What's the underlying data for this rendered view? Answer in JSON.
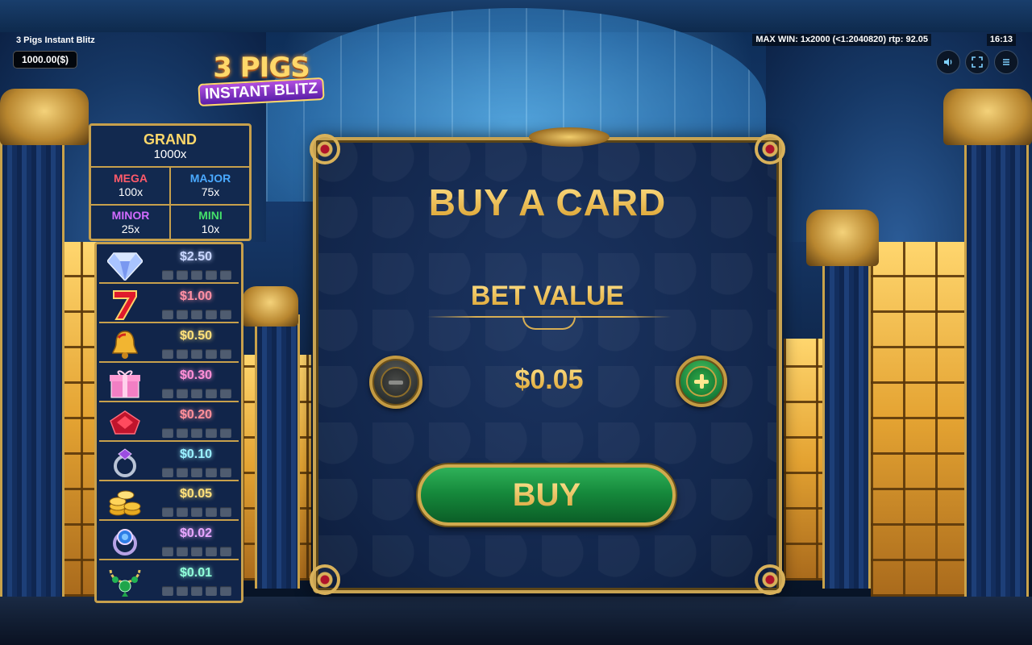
{
  "hud": {
    "game_title": "3 Pigs Instant Blitz",
    "balance": "1000.00($)",
    "max_win_info": "MAX WIN: 1x2000 (<1:2040820) rtp: 92.05",
    "clock": "16:13",
    "sound_icon": "speaker-icon",
    "fullscreen_icon": "fullscreen-icon",
    "menu_icon": "hamburger-menu-icon"
  },
  "logo": {
    "line1": "3 PIGS",
    "line2": "INSTANT BLITZ"
  },
  "jackpots": {
    "grand": {
      "label": "GRAND",
      "multiplier": "1000x",
      "color": "#ffd86a"
    },
    "mega": {
      "label": "MEGA",
      "multiplier": "100x",
      "color": "#ff5a6a"
    },
    "major": {
      "label": "MAJOR",
      "multiplier": "75x",
      "color": "#49a9ff"
    },
    "minor": {
      "label": "MINOR",
      "multiplier": "25x",
      "color": "#d26bff"
    },
    "mini": {
      "label": "MINI",
      "multiplier": "10x",
      "color": "#45e06a"
    }
  },
  "paytable": [
    {
      "icon": "diamond-icon",
      "prize": "$2.50",
      "color": "#c9d6ff"
    },
    {
      "icon": "seven-icon",
      "prize": "$1.00",
      "color": "#ff8fa4"
    },
    {
      "icon": "bell-icon",
      "prize": "$0.50",
      "color": "#ffe07a"
    },
    {
      "icon": "gift-box-icon",
      "prize": "$0.30",
      "color": "#ff8fd6"
    },
    {
      "icon": "ruby-icon",
      "prize": "$0.20",
      "color": "#ff8f9a"
    },
    {
      "icon": "amethyst-ring-icon",
      "prize": "$0.10",
      "color": "#9af0ff"
    },
    {
      "icon": "gold-coins-icon",
      "prize": "$0.05",
      "color": "#ffe07a"
    },
    {
      "icon": "sapphire-ring-icon",
      "prize": "$0.02",
      "color": "#e7a6ff"
    },
    {
      "icon": "emerald-necklace-icon",
      "prize": "$0.01",
      "color": "#8fffd9"
    }
  ],
  "card_panel": {
    "title": "BUY A CARD",
    "bet_label": "BET VALUE",
    "bet_value": "$0.05",
    "buy_label": "BUY"
  }
}
